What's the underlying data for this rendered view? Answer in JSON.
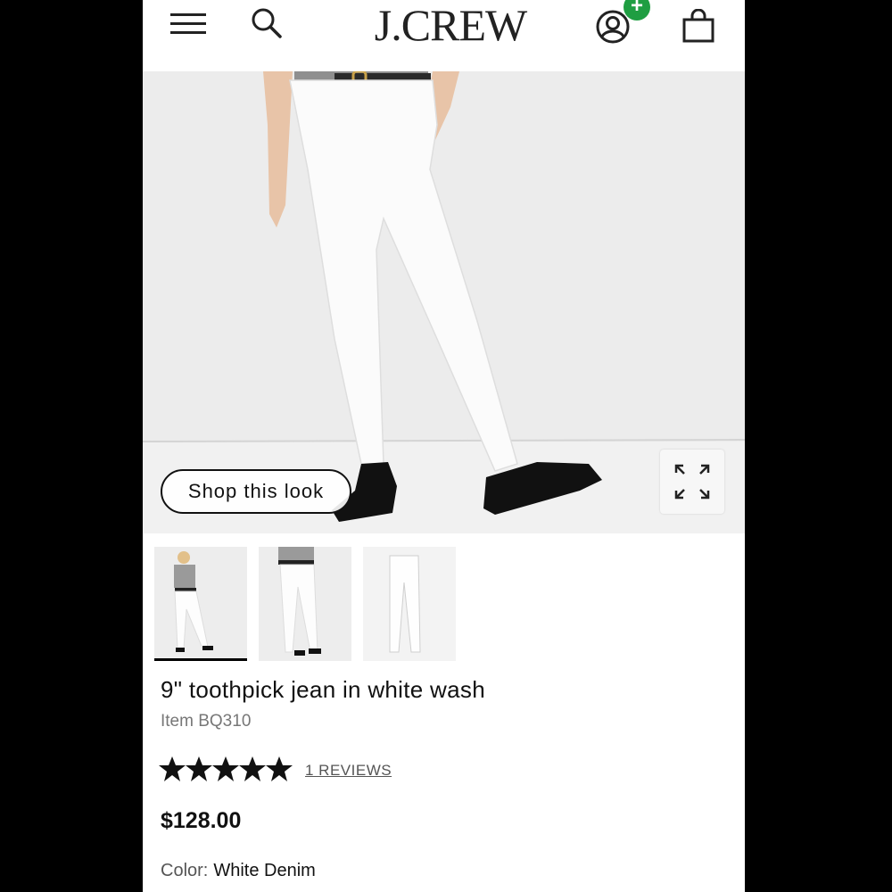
{
  "header": {
    "logo": "J.CREW",
    "icons": [
      "menu-icon",
      "search-icon",
      "account-icon",
      "bag-icon"
    ],
    "badge": "+"
  },
  "hero": {
    "shop_this_look": "Shop this look",
    "expand_icon": "expand-icon"
  },
  "thumbnails": [
    {
      "label": "model-full-view",
      "selected": true
    },
    {
      "label": "model-closeup-view",
      "selected": false
    },
    {
      "label": "product-flat-view",
      "selected": false
    }
  ],
  "product": {
    "title": "9\" toothpick jean in white wash",
    "item": "Item BQ310",
    "rating": 5,
    "reviews": "1 REVIEWS",
    "price": "$128.00",
    "color_label": "Color:",
    "color_value": "White Denim"
  },
  "colors": {
    "badge": "#1f9e42",
    "text": "#111111",
    "muted": "#777777",
    "hero_bg": "#ececec"
  }
}
